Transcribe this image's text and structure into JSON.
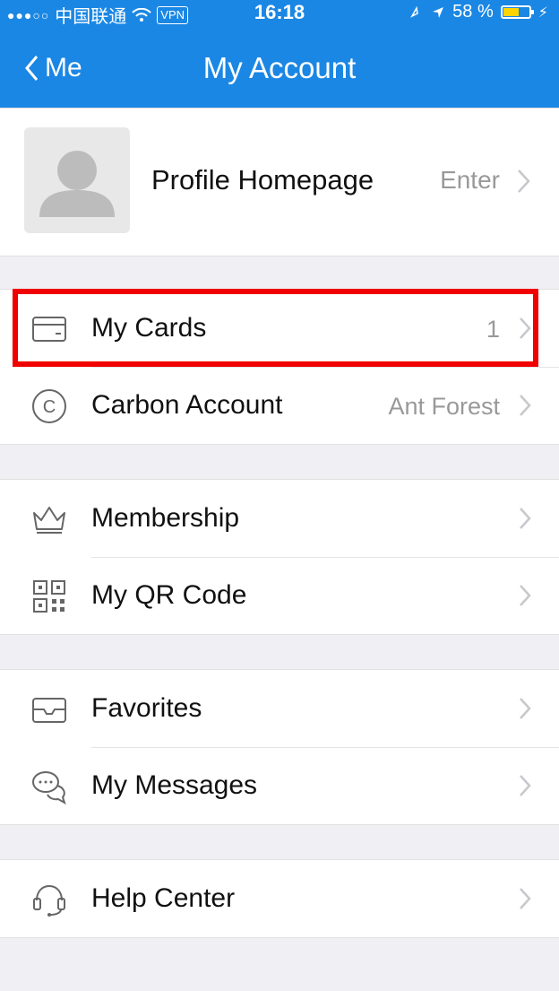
{
  "status_bar": {
    "carrier": "中国联通",
    "vpn": "VPN",
    "time": "16:18",
    "battery": "58 %",
    "battery_level": 0.58
  },
  "nav": {
    "back_label": "Me",
    "title": "My Account"
  },
  "profile": {
    "label": "Profile Homepage",
    "value": "Enter"
  },
  "groups": [
    {
      "items": [
        {
          "icon": "card-icon",
          "label": "My Cards",
          "value": "1",
          "highlighted": true
        },
        {
          "icon": "carbon-icon",
          "label": "Carbon Account",
          "value": "Ant Forest"
        }
      ]
    },
    {
      "items": [
        {
          "icon": "crown-icon",
          "label": "Membership",
          "value": ""
        },
        {
          "icon": "qr-code-icon",
          "label": "My QR Code",
          "value": ""
        }
      ]
    },
    {
      "items": [
        {
          "icon": "envelope-icon",
          "label": "Favorites",
          "value": ""
        },
        {
          "icon": "chat-bubbles-icon",
          "label": "My Messages",
          "value": ""
        }
      ]
    },
    {
      "items": [
        {
          "icon": "headset-icon",
          "label": "Help Center",
          "value": ""
        }
      ]
    }
  ],
  "colors": {
    "header_bg": "#1b87e4",
    "page_bg": "#efeff4",
    "highlight": "#f00000",
    "secondary_text": "#999999"
  }
}
